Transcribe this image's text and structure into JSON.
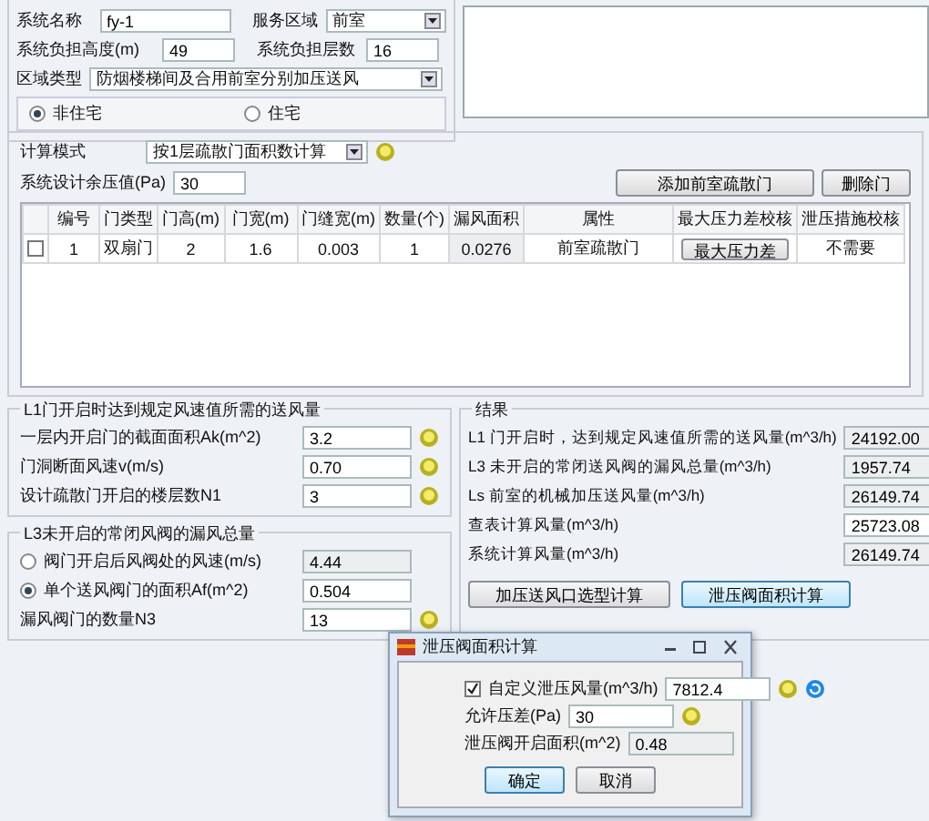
{
  "system": {
    "name_label": "系统名称",
    "name_value": "fy-1",
    "area_label": "服务区域",
    "area_value": "前室",
    "height_label": "系统负担高度(m)",
    "height_value": "49",
    "floors_label": "系统负担层数",
    "floors_value": "16",
    "zone_label": "区域类型",
    "zone_value": "防烟楼梯间及合用前室分别加压送风",
    "building_types": [
      {
        "label": "非住宅",
        "selected": true
      },
      {
        "label": "住宅",
        "selected": false
      }
    ]
  },
  "calc": {
    "mode_label": "计算模式",
    "mode_value": "按1层疏散门面积数计算",
    "pressure_label": "系统设计余压值(Pa)",
    "pressure_value": "30",
    "buttons": [
      "添加前室疏散门",
      "删除门"
    ]
  },
  "table": {
    "columns": [
      "编号",
      "门类型",
      "门高(m)",
      "门宽(m)",
      "门缝宽(m)",
      "数量(个)",
      "漏风面积",
      "属性",
      "最大压力差校核",
      "泄压措施校核"
    ],
    "rows": [
      {
        "checked": false,
        "cells": [
          "1",
          "双扇门",
          "2",
          "1.6",
          "0.003",
          "1",
          "0.0276",
          "前室疏散门"
        ],
        "button": "最大压力差",
        "relief": "不需要"
      }
    ]
  },
  "l1": {
    "title": "L1门开启时达到规定风速值所需的送风量",
    "rows": [
      {
        "label": "一层内开启门的截面面积Ak(m^2)",
        "value": "3.2"
      },
      {
        "label": "门洞断面风速v(m/s)",
        "value": "0.70"
      },
      {
        "label": "设计疏散门开启的楼层数N1",
        "value": "3"
      }
    ]
  },
  "l3": {
    "title": "L3未开启的常闭风阀的漏风总量",
    "rows": [
      {
        "kind": "radio",
        "label": "阀门开启后风阀处的风速(m/s)",
        "value": "4.44",
        "selected": false
      },
      {
        "kind": "radio",
        "label": "单个送风阀门的面积Af(m^2)",
        "value": "0.504",
        "selected": true
      },
      {
        "kind": "plain",
        "label": "漏风阀门的数量N3",
        "value": "13"
      }
    ]
  },
  "results": {
    "title": "结果",
    "rows": [
      {
        "label": "L1 门开启时，达到规定风速值所需的送风量(m^3/h)",
        "value": "24192.00",
        "readonly": true
      },
      {
        "label": "L3 未开启的常闭送风阀的漏风总量(m^3/h)",
        "value": "1957.74",
        "readonly": true
      },
      {
        "label": "Ls 前室的机械加压送风量(m^3/h)",
        "value": "26149.74",
        "readonly": true
      },
      {
        "label": "查表计算风量(m^3/h)",
        "value": "25723.08",
        "readonly": false
      },
      {
        "label": "系统计算风量(m^3/h)",
        "value": "26149.74",
        "readonly": true
      }
    ],
    "buttons": [
      {
        "label": "加压送风口选型计算",
        "selected": false
      },
      {
        "label": "泄压阀面积计算",
        "selected": true
      }
    ]
  },
  "dialog": {
    "title": "泄压阀面积计算",
    "rows": [
      {
        "kind": "checkbox",
        "checked": true,
        "label": "自定义泄压风量(m^3/h)",
        "value": "7812.4",
        "readonly": false
      },
      {
        "kind": "plain",
        "label": "允许压差(Pa)",
        "value": "30",
        "readonly": false
      },
      {
        "kind": "plain",
        "label": "泄压阀开启面积(m^2)",
        "value": "0.48",
        "readonly": true
      }
    ],
    "buttons": [
      "确定",
      "取消"
    ]
  }
}
